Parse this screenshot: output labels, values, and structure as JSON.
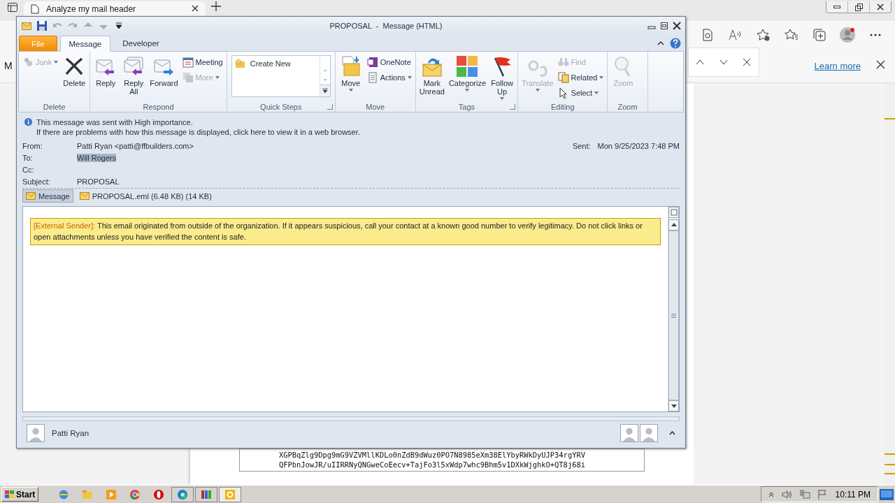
{
  "browser": {
    "tab_title": "Analyze my mail header",
    "page_letter": "M",
    "learn_more": "Learn more",
    "textbox_lines": [
      "XGPBqZlg9Dpg9mG9VZVMllKDLo0nZdB9dWuz0PO7N8985eXm38ElYbyRWkDyUJP34rgYRV",
      "QFPbnJowJR/uIIRRNyQNGweCoEecv+TajFo3l5xWdp7whc9Bhm5v1DXkWjghkO+QT8j68i"
    ]
  },
  "window": {
    "title": "PROPOSAL  -  Message (HTML)"
  },
  "tabs": [
    {
      "label": "File",
      "kind": "file",
      "selected": false
    },
    {
      "label": "Message",
      "kind": "tab",
      "selected": true
    },
    {
      "label": "Developer",
      "kind": "tab",
      "selected": false
    }
  ],
  "ribbon": [
    {
      "label": "Delete",
      "launcher": false,
      "items": [
        {
          "label": "Junk",
          "kind": "small",
          "disabled": true,
          "dropdown": true
        },
        {
          "label": "Delete",
          "kind": "large",
          "disabled": false,
          "dropdown": false
        }
      ]
    },
    {
      "label": "Respond",
      "launcher": false,
      "items": [
        {
          "label": "Reply",
          "kind": "large",
          "disabled": false,
          "dropdown": false
        },
        {
          "label": "Reply All",
          "kind": "large",
          "disabled": false,
          "dropdown": false
        },
        {
          "label": "Forward",
          "kind": "large",
          "disabled": false,
          "dropdown": false
        },
        {
          "label": "Meeting",
          "kind": "small",
          "disabled": false,
          "dropdown": false
        },
        {
          "label": "More",
          "kind": "small",
          "disabled": true,
          "dropdown": true
        }
      ]
    },
    {
      "label": "Quick Steps",
      "launcher": true,
      "items": [
        {
          "label": "Create New",
          "kind": "gallery"
        }
      ]
    },
    {
      "label": "Move",
      "launcher": false,
      "items": [
        {
          "label": "Move",
          "kind": "large",
          "disabled": false,
          "dropdown": true
        },
        {
          "label": "OneNote",
          "kind": "small",
          "disabled": false,
          "dropdown": false
        },
        {
          "label": "Actions",
          "kind": "small",
          "disabled": false,
          "dropdown": true
        }
      ]
    },
    {
      "label": "Tags",
      "launcher": true,
      "items": [
        {
          "label": "Mark Unread",
          "kind": "large",
          "disabled": false,
          "dropdown": false
        },
        {
          "label": "Categorize",
          "kind": "large",
          "disabled": false,
          "dropdown": true
        },
        {
          "label": "Follow Up",
          "kind": "large",
          "disabled": false,
          "dropdown": true
        }
      ]
    },
    {
      "label": "Editing",
      "launcher": false,
      "items": [
        {
          "label": "Translate",
          "kind": "large",
          "disabled": true,
          "dropdown": true
        },
        {
          "label": "Find",
          "kind": "small",
          "disabled": true,
          "dropdown": false
        },
        {
          "label": "Related",
          "kind": "small",
          "disabled": false,
          "dropdown": true
        },
        {
          "label": "Select",
          "kind": "small",
          "disabled": false,
          "dropdown": true
        }
      ]
    },
    {
      "label": "Zoom",
      "launcher": false,
      "items": [
        {
          "label": "Zoom",
          "kind": "large",
          "disabled": true,
          "dropdown": false
        }
      ]
    }
  ],
  "info": [
    "This message was sent with High importance.",
    "If there are problems with how this message is displayed, click here to view it in a web browser."
  ],
  "headers": [
    {
      "label": "From:",
      "value": "Patti Ryan <patti@ffbuilders.com>",
      "selected": false
    },
    {
      "label": "To:",
      "value": "Will Rogers",
      "selected": true
    },
    {
      "label": "Cc:"
    },
    {
      "label": "Subject:",
      "value": "PROPOSAL",
      "selected": false
    }
  ],
  "sent": {
    "label": "Sent:",
    "value": "Mon 9/25/2023 7:48 PM"
  },
  "attachments": [
    {
      "label": "Message",
      "selected": true
    },
    {
      "label": "PROPOSAL.eml (6.48 KB) (14 KB)",
      "selected": false
    }
  ],
  "banner": {
    "tag": "[External Sender]:",
    "text": " This email originated from outside of the organization. If it appears suspicious, call your contact at a known good number to verify legitimacy. Do not click links or open attachments unless you have verified the content is safe."
  },
  "people_pane": {
    "name": "Patti Ryan"
  },
  "taskbar": {
    "start": "Start",
    "time": "10:11 PM"
  }
}
